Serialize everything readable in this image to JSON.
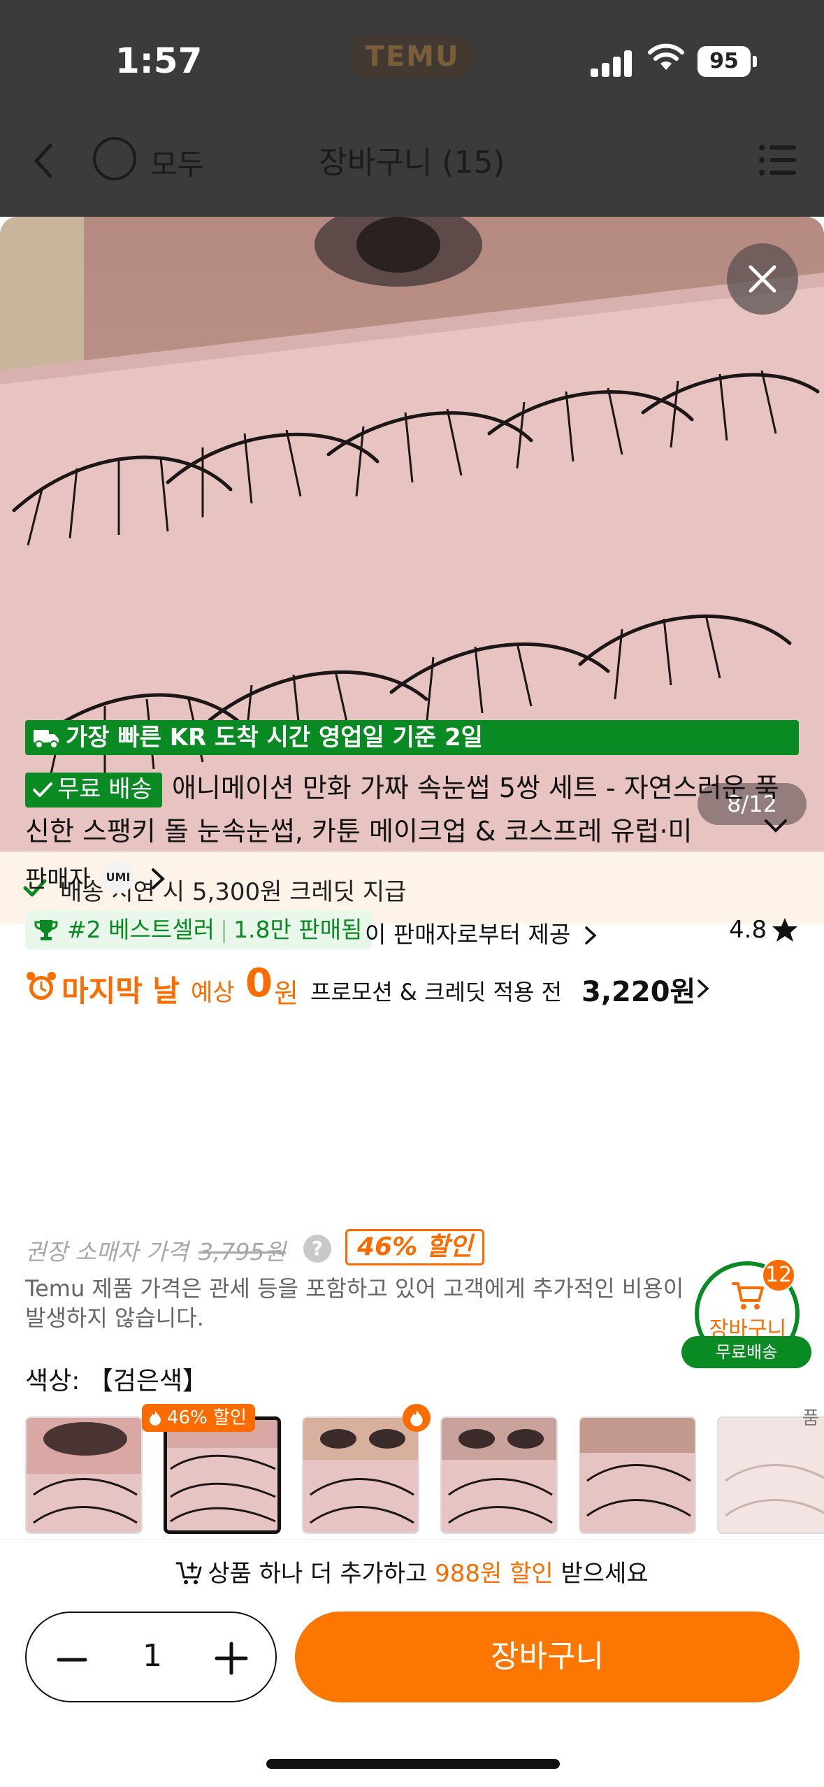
{
  "status_bar": {
    "time": "1:57",
    "app_badge": "TEMU",
    "battery": "95"
  },
  "header": {
    "select_all_label": "모두",
    "title": "장바구니 (15)"
  },
  "gallery": {
    "counter": "8/12"
  },
  "credit_notice": "배송 지연 시 5,300원 크레딧 지급",
  "fast_delivery": "가장 빠른 KR 도착 시간 영업일 기준 2일",
  "product": {
    "free_shipping_badge": "무료 배송",
    "title": "애니메이션 만화 가짜 속눈썹 5쌍 세트 - 자연스러운 푹신한 스팽키 돌 눈속눈썹, 카툰 메이크업 & 코스프레 유럽·미",
    "seller_label": "판매자",
    "seller_logo": "UMI",
    "bestseller_rank": "#2 베스트셀러",
    "sold_count": "1.8만 판매됨",
    "provider_text": "이 판매자로부터 제공",
    "rating": "4.8"
  },
  "price": {
    "last_day": "마지막 날",
    "expected_label": "예상",
    "expected_value": "0",
    "won": "원",
    "promo_label": "프로모션 & 크레딧 적용 전",
    "original_price": "3,220원",
    "rrp_label": "권장 소매자 가격",
    "rrp_value": "3,795원",
    "discount": "46% 할인",
    "note": "Temu 제품 가격은 관세 등을 포함하고 있어 고객에게 추가적인 비용이 발생하지 않습니다."
  },
  "floating_cart": {
    "count": "12",
    "label": "장바구니",
    "free": "무료배송"
  },
  "color": {
    "label": "색상: 【검은색】",
    "thumb_badge": "46% 할인",
    "cut_label": "품"
  },
  "upsell": {
    "prefix": "상품 하나 더 추가하고",
    "amount": "988원 할인",
    "suffix": "받으세요"
  },
  "quantity": "1",
  "cart_button": "장바구니",
  "colors": {
    "accent": "#fb7701",
    "green": "#0a8a23",
    "header": "#3b3b3b"
  }
}
